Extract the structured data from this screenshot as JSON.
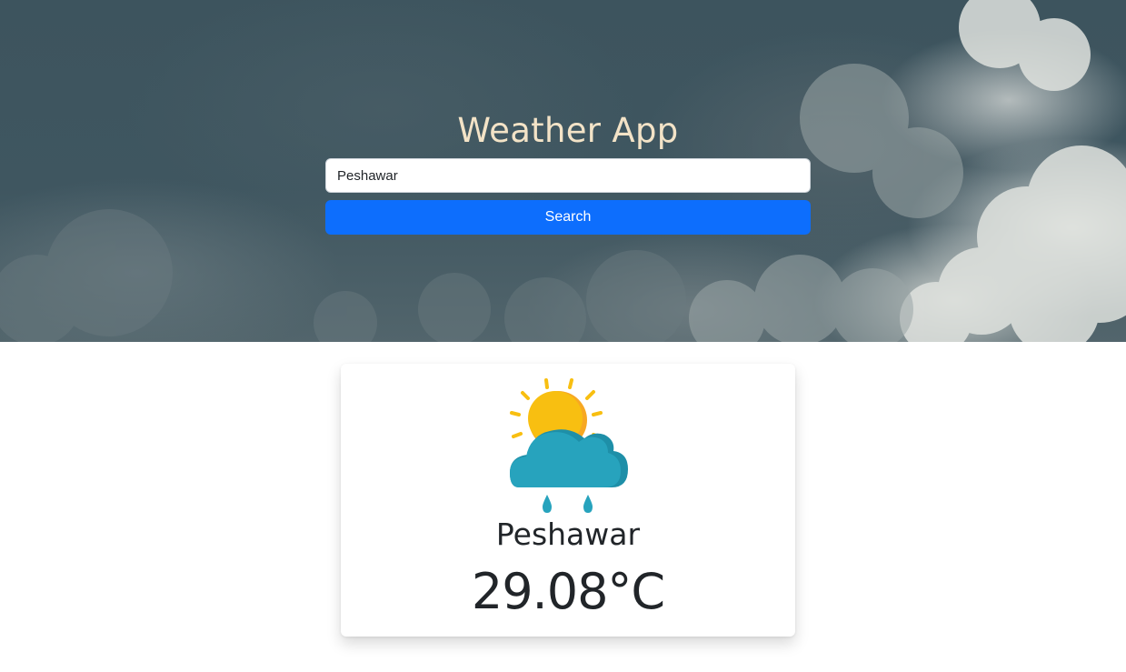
{
  "header": {
    "title": "Weather App",
    "search_value": "Peshawar",
    "search_button_label": "Search"
  },
  "weather_card": {
    "icon": "sun-cloud-rain-icon",
    "city": "Peshawar",
    "temperature": "29.08°C"
  },
  "colors": {
    "title": "#f3e3c7",
    "button": "#0d6efd",
    "cloud_icon": "#27a3bd",
    "sun_icon": "#f8bf11"
  }
}
